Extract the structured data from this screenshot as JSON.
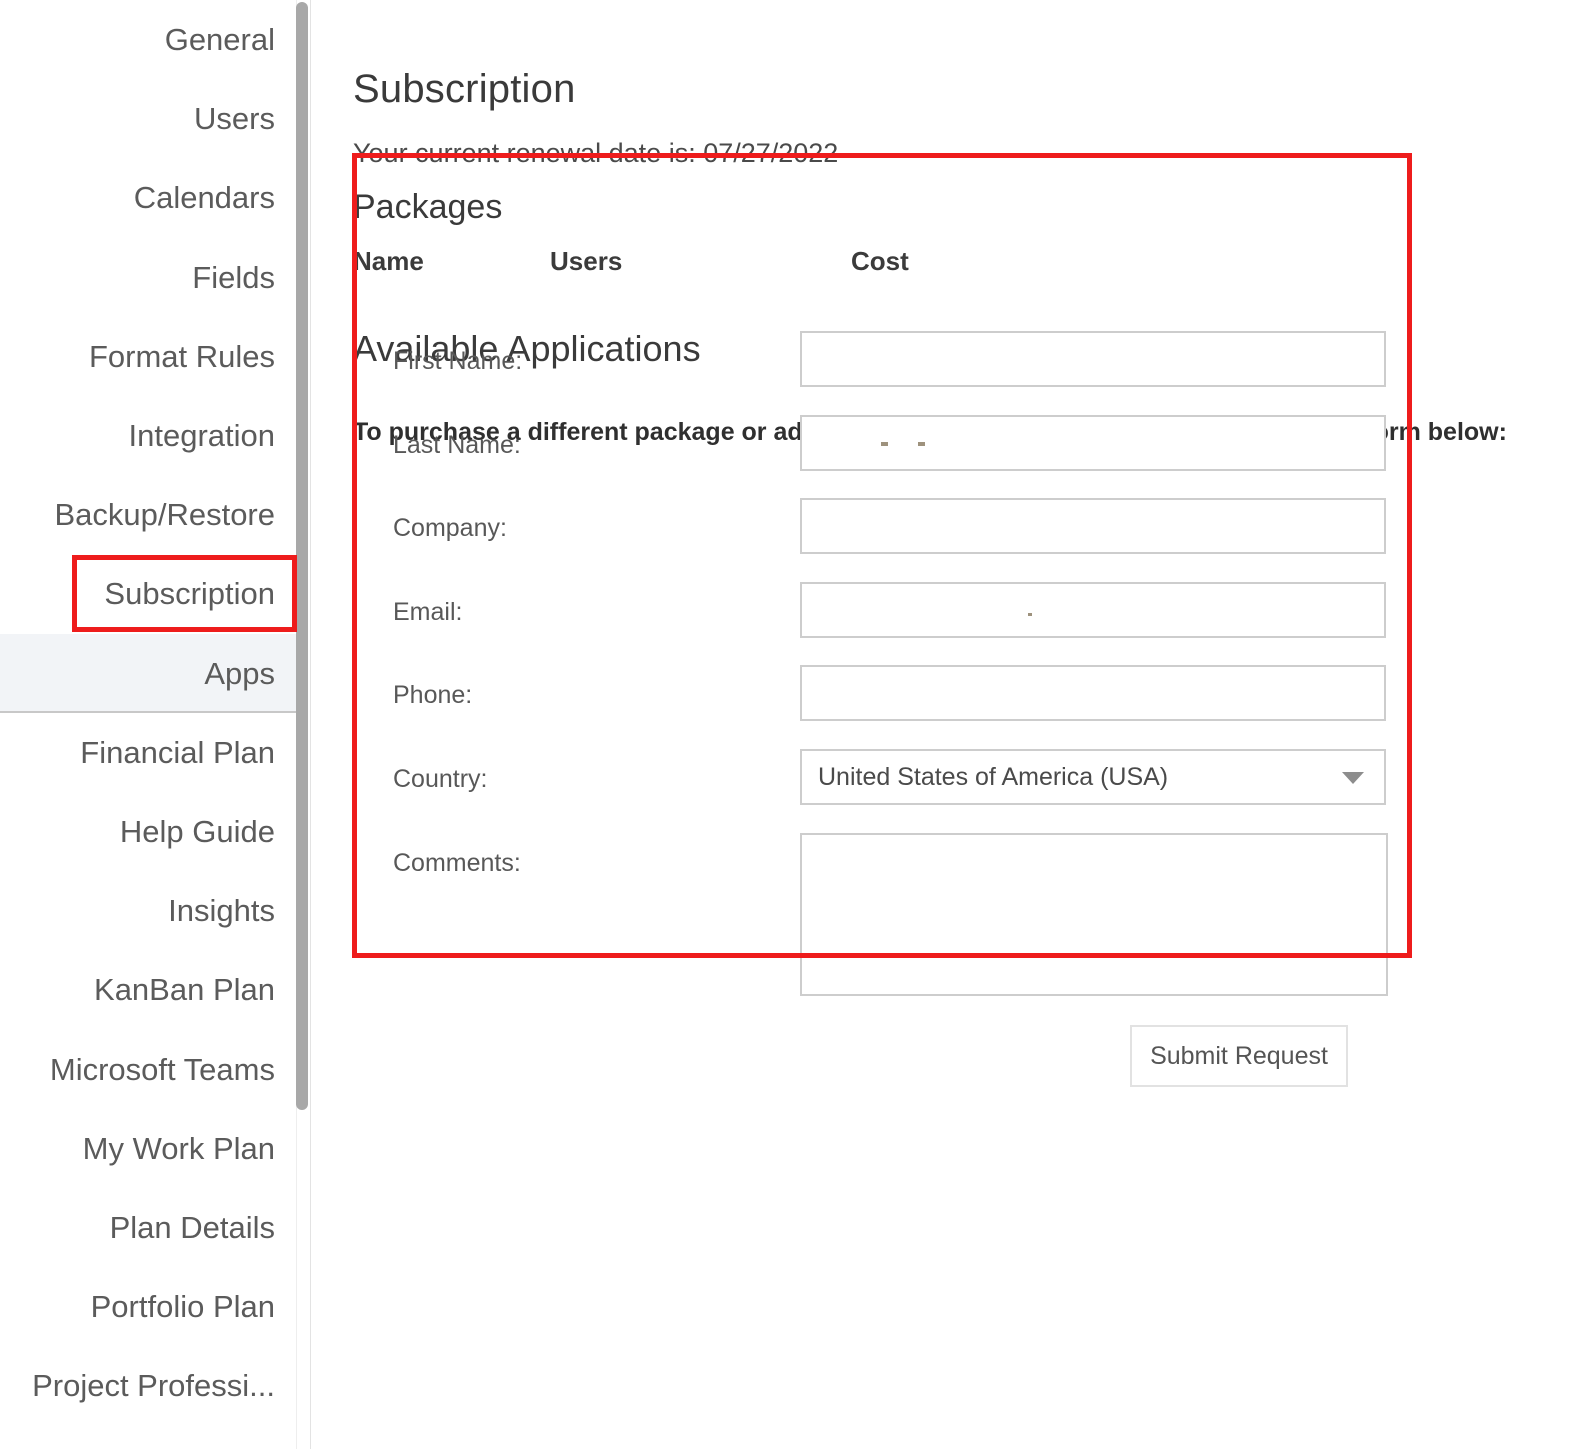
{
  "sidebar": {
    "items": [
      {
        "label": "General",
        "state": "normal"
      },
      {
        "label": "Users",
        "state": "normal"
      },
      {
        "label": "Calendars",
        "state": "normal"
      },
      {
        "label": "Fields",
        "state": "normal"
      },
      {
        "label": "Format Rules",
        "state": "normal"
      },
      {
        "label": "Integration",
        "state": "normal"
      },
      {
        "label": "Backup/Restore",
        "state": "normal"
      },
      {
        "label": "Subscription",
        "state": "highlighted"
      },
      {
        "label": "Apps",
        "state": "selected"
      },
      {
        "label": "Financial Plan",
        "state": "normal"
      },
      {
        "label": "Help Guide",
        "state": "normal"
      },
      {
        "label": "Insights",
        "state": "normal"
      },
      {
        "label": "KanBan Plan",
        "state": "normal"
      },
      {
        "label": "Microsoft Teams",
        "state": "normal"
      },
      {
        "label": "My Work Plan",
        "state": "normal"
      },
      {
        "label": "Plan Details",
        "state": "normal"
      },
      {
        "label": "Portfolio Plan",
        "state": "normal"
      },
      {
        "label": "Project Professi...",
        "state": "normal"
      }
    ],
    "scrollbar": "vertical-scrollbar"
  },
  "main": {
    "page_title": "Subscription",
    "renewal_text": "Your current renewal date is: 07/27/2022",
    "packages": {
      "title": "Packages",
      "columns": [
        "Name",
        "Users",
        "Cost"
      ],
      "rows": []
    },
    "available_applications_title": "Available Applications",
    "contact_instruction": "To purchase a different package or add additional users, please contact us using the form below:"
  },
  "form": {
    "fields": [
      {
        "label": "First Name:",
        "value": "",
        "placeholder": "",
        "type": "text"
      },
      {
        "label": "Last Name:",
        "value": "",
        "placeholder": "",
        "type": "text"
      },
      {
        "label": "Company:",
        "value": "",
        "placeholder": "",
        "type": "text"
      },
      {
        "label": "Email:",
        "value": "",
        "placeholder": "",
        "type": "text"
      },
      {
        "label": "Phone:",
        "value": "",
        "placeholder": "",
        "type": "text"
      }
    ],
    "country": {
      "label": "Country:",
      "selected": "United States of America (USA)",
      "caret_icon": "chevron-down-icon"
    },
    "comments": {
      "label": "Comments:",
      "value": "",
      "placeholder": ""
    },
    "submit_label": "Submit Request"
  },
  "colors": {
    "annotation_red": "#ee1c1c",
    "accent_blue": "#3a76d8",
    "selected_row_bg": "#f2f4f7",
    "text_gray": "#5b5b5b",
    "border_gray": "#cdcdcd"
  }
}
